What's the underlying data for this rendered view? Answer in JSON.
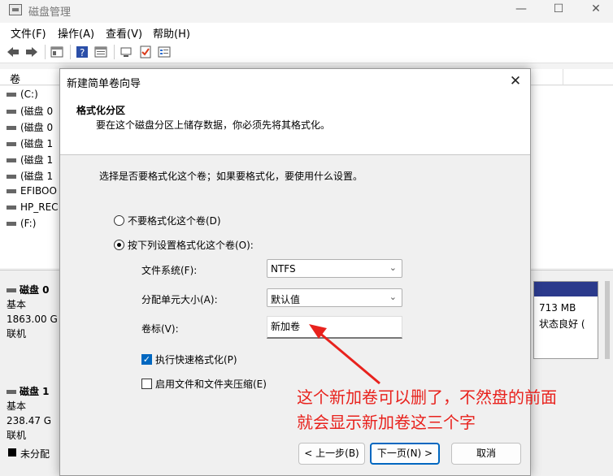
{
  "app": {
    "title": "磁盘管理",
    "controls": {
      "minimize": "—",
      "maximize": "☐",
      "close": "✕"
    }
  },
  "menu": [
    "文件(F)",
    "操作(A)",
    "查看(V)",
    "帮助(H)"
  ],
  "list": {
    "col_volume": "卷",
    "volumes": [
      "(C:)",
      "(磁盘 0 ",
      "(磁盘 0 ",
      "(磁盘 1 ",
      "(磁盘 1 ",
      "(磁盘 1 ",
      "EFIBOO",
      "HP_REC",
      "(F:)"
    ]
  },
  "disks": [
    {
      "name": "磁盘 0",
      "type": "基本",
      "size": "1863.00 G",
      "status": "联机"
    },
    {
      "name": "磁盘 1",
      "type": "基本",
      "size": "238.47 G",
      "status": "联机"
    }
  ],
  "partition_right": {
    "size": "713 MB",
    "status": "状态良好 ("
  },
  "legend": {
    "unallocated": "未分配"
  },
  "dialog": {
    "title": "新建简单卷向导",
    "close": "✕",
    "header_title": "格式化分区",
    "header_desc": "要在这个磁盘分区上储存数据，你必须先将其格式化。",
    "prompt": "选择是否要格式化这个卷；如果要格式化，要使用什么设置。",
    "radio_no_format": "不要格式化这个卷(D)",
    "radio_format": "按下列设置格式化这个卷(O):",
    "selected_radio": "format",
    "fs_label": "文件系统(F):",
    "fs_value": "NTFS",
    "alloc_label": "分配单元大小(A):",
    "alloc_value": "默认值",
    "volume_label": "卷标(V):",
    "volume_value": "新加卷",
    "quick_format": "执行快速格式化(P)",
    "quick_format_checked": true,
    "compress": "启用文件和文件夹压缩(E)",
    "compress_checked": false,
    "btn_back": "< 上一步(B)",
    "btn_next": "下一页(N) >",
    "btn_cancel": "取消"
  },
  "annotation": {
    "line1": "这个新加卷可以删了，不然盘的前面",
    "line2": "就会显示新加卷这三个字",
    "color": "#e8221d"
  }
}
